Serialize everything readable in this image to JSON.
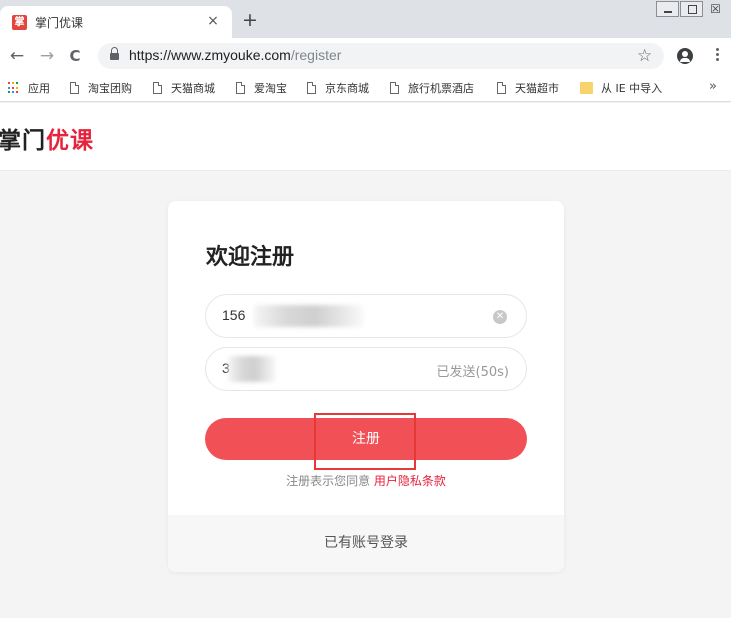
{
  "browser": {
    "tab": {
      "favicon_char": "掌",
      "title": "掌门优课",
      "close": "×"
    },
    "newtab": "+",
    "window": {
      "close": "☒"
    },
    "nav": {
      "back": "←",
      "forward": "→",
      "reload": "C"
    },
    "address": {
      "host": "https://www.zmyouke.com",
      "path": "/register"
    },
    "bookmarks": [
      {
        "label": "应用",
        "icon": "apps-icon"
      },
      {
        "label": "淘宝团购",
        "icon": "page-icon"
      },
      {
        "label": "天猫商城",
        "icon": "page-icon"
      },
      {
        "label": "爱淘宝",
        "icon": "page-icon"
      },
      {
        "label": "京东商城",
        "icon": "page-icon"
      },
      {
        "label": "旅行机票酒店",
        "icon": "page-icon"
      },
      {
        "label": "天猫超市",
        "icon": "page-icon"
      },
      {
        "label": "从 IE 中导入",
        "icon": "folder-icon"
      }
    ],
    "bookmarks_more": "»"
  },
  "site": {
    "logo_part1": "掌门",
    "logo_part2": "优课",
    "brand_color": "#e5233d"
  },
  "register": {
    "title": "欢迎注册",
    "phone_value": "156",
    "code_value": "3",
    "resend_label": "已发送(50s)",
    "submit_label": "注册",
    "agree_text": "注册表示您同意",
    "agree_link": "用户隐私条款",
    "login_link": "已有账号登录",
    "accent_color": "#f15057"
  }
}
